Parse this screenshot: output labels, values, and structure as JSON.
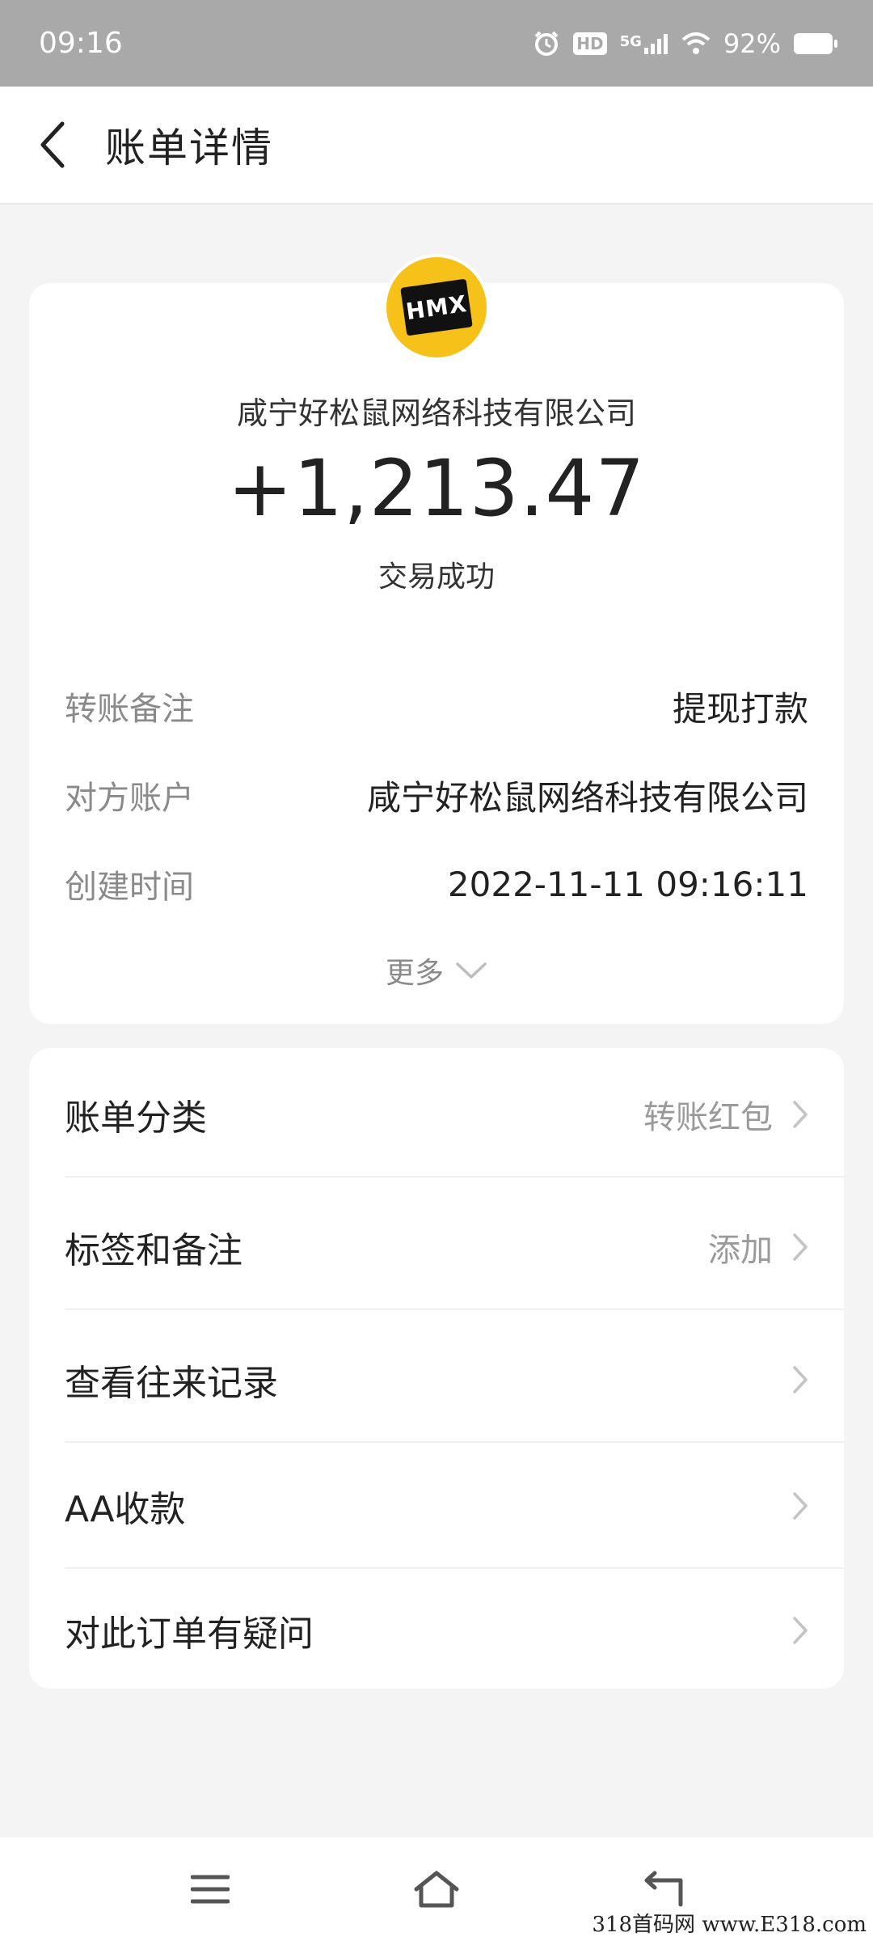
{
  "status_bar": {
    "time": "09:16",
    "network": "5G",
    "hd_badge": "HD",
    "battery": "92%"
  },
  "header": {
    "title": "账单详情",
    "back_icon": "chevron-left-icon"
  },
  "summary": {
    "merchant_logo_text": "HMX",
    "merchant_name": "咸宁好松鼠网络科技有限公司",
    "amount": "+1,213.47",
    "status": "交易成功",
    "details": [
      {
        "label": "转账备注",
        "value": "提现打款"
      },
      {
        "label": "对方账户",
        "value": "咸宁好松鼠网络科技有限公司"
      },
      {
        "label": "创建时间",
        "value": "2022-11-11 09:16:11"
      }
    ],
    "more_label": "更多"
  },
  "menu": {
    "items": [
      {
        "label": "账单分类",
        "value": "转账红包"
      },
      {
        "label": "标签和备注",
        "value": "添加"
      },
      {
        "label": "查看往来记录",
        "value": ""
      },
      {
        "label": "AA收款",
        "value": ""
      },
      {
        "label": "对此订单有疑问",
        "value": ""
      }
    ]
  },
  "watermark": "318首码网 www.E318.com",
  "colors": {
    "status_bar_bg": "#a9a9a9",
    "page_bg": "#f4f4f4",
    "logo_yellow": "#f6c21a",
    "label_gray": "#8a8a8a"
  }
}
